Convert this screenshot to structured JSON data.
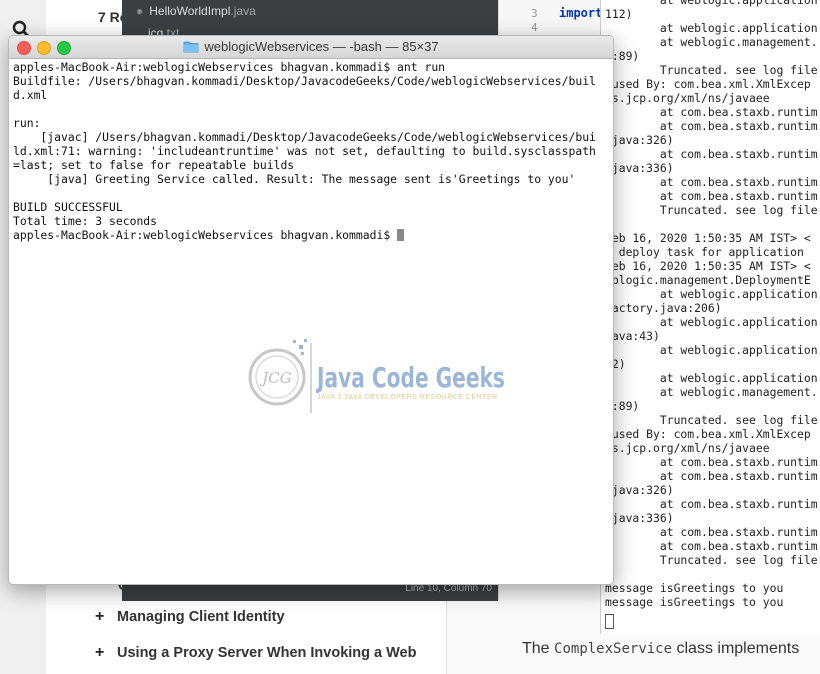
{
  "doc": {
    "toc_heading": "7 Ro",
    "toc_items": [
      {
        "label": "Managing Client Identity"
      },
      {
        "label": "Using a Proxy Server When Invoking a Web"
      }
    ],
    "toc_partial": "C",
    "body_prefix": "The",
    "body_code": "ComplexService",
    "body_suffix": "class implements"
  },
  "ide": {
    "files": [
      {
        "name": "HelloWorldImpl",
        "ext": ".java"
      },
      {
        "name": "jcg",
        "ext": ".txt"
      }
    ],
    "status": "Line 10, Column 70"
  },
  "code": {
    "line_numbers": [
      "3",
      "4"
    ],
    "import_kw": "import"
  },
  "console": {
    "lines": [
      "        at weblogic.application",
      "112)",
      "        at weblogic.application",
      "        at weblogic.management.",
      "a:89)",
      "        Truncated. see log file",
      "aused By: com.bea.xml.XmlExcep",
      "ns.jcp.org/xml/ns/javaee",
      "        at com.bea.staxb.runtim",
      "        at com.bea.staxb.runtim",
      ".java:326)",
      "        at com.bea.staxb.runtim",
      ".java:336)",
      "        at com.bea.staxb.runtim",
      "        at com.bea.staxb.runtim",
      "        Truncated. see log file",
      "",
      "Feb 16, 2020 1:50:35 AM IST> <",
      "g deploy task for application",
      "Feb 16, 2020 1:50:35 AM IST> <",
      "eblogic.management.DeploymentE",
      "        at weblogic.application",
      "Factory.java:206)",
      "        at weblogic.application",
      "java:43)",
      "        at weblogic.application",
      "12)",
      "        at weblogic.application",
      "        at weblogic.management.",
      "a:89)",
      "        Truncated. see log file",
      "aused By: com.bea.xml.XmlExcep",
      "ns.jcp.org/xml/ns/javaee",
      "        at com.bea.staxb.runtim",
      "        at com.bea.staxb.runtim",
      ".java:326)",
      "        at com.bea.staxb.runtim",
      ".java:336)",
      "        at com.bea.staxb.runtim",
      "        at com.bea.staxb.runtim",
      "        Truncated. see log file",
      "",
      "message isGreetings to you",
      "message isGreetings to you"
    ]
  },
  "terminal": {
    "title": "weblogicWebservices — -bash — 85×37",
    "lines": [
      "apples-MacBook-Air:weblogicWebservices bhagvan.kommadi$ ant run",
      "Buildfile: /Users/bhagvan.kommadi/Desktop/JavacodeGeeks/Code/weblogicWebservices/buil",
      "d.xml",
      "",
      "run:",
      "    [javac] /Users/bhagvan.kommadi/Desktop/JavacodeGeeks/Code/weblogicWebservices/bui",
      "ld.xml:71: warning: 'includeantruntime' was not set, defaulting to build.sysclasspath",
      "=last; set to false for repeatable builds",
      "     [java] Greeting Service called. Result: The message sent is'Greetings to you'",
      "",
      "BUILD SUCCESSFUL",
      "Total time: 3 seconds"
    ],
    "prompt": "apples-MacBook-Air:weblogicWebservices bhagvan.kommadi$ "
  },
  "watermark": {
    "logo_text": "JCG",
    "brand": "Java Code Geeks",
    "tagline": "JAVA 2 JAVA DEVELOPERS RESOURCE CENTER"
  },
  "colors": {
    "close": "#fc5f57",
    "minimize": "#fdbc2e",
    "maximize": "#28c840",
    "folder": "#5ab0f0"
  }
}
